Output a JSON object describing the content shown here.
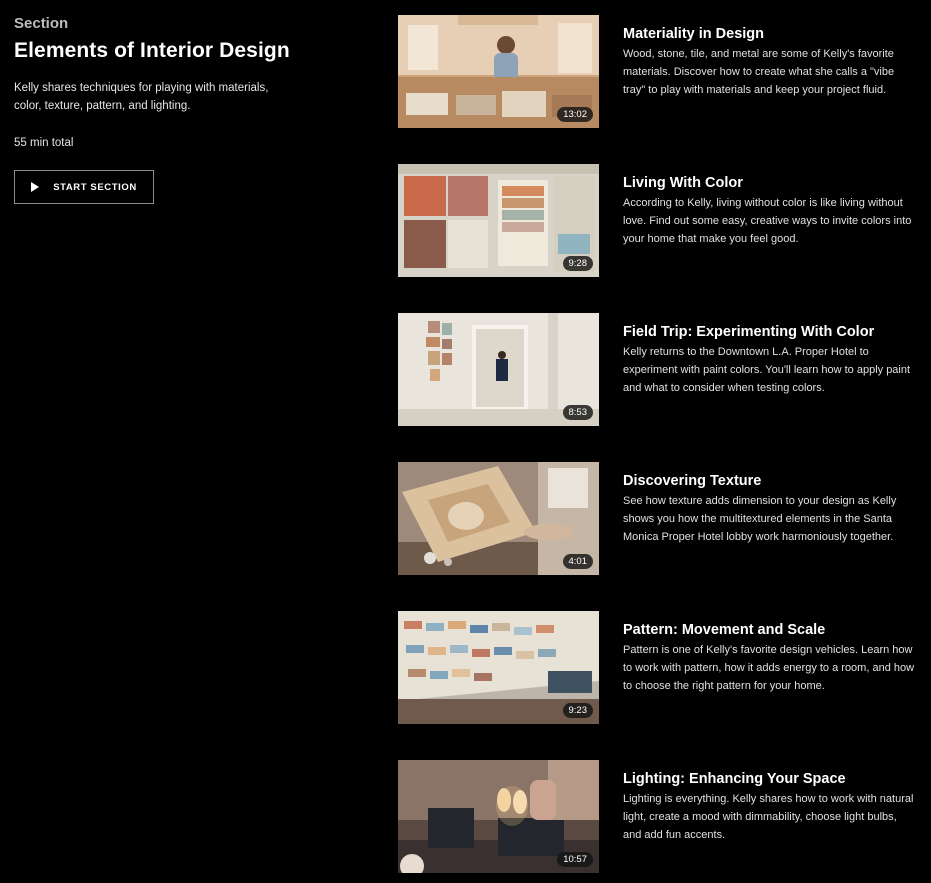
{
  "section": {
    "label": "Section",
    "title": "Elements of Interior Design",
    "description": "Kelly shares techniques for playing with materials, color, texture, pattern, and lighting.",
    "total": "55 min total",
    "start_button": "START SECTION"
  },
  "lessons": [
    {
      "title": "Materiality in Design",
      "description": "Wood, stone, tile, and metal are some of Kelly's favorite materials. Discover how to create what she calls a \"vibe tray\" to play with materials and keep your project fluid.",
      "duration": "13:02"
    },
    {
      "title": "Living With Color",
      "description": "According to Kelly, living without color is like living without love. Find out some easy, creative ways to invite colors into your home that make you feel good.",
      "duration": "9:28"
    },
    {
      "title": "Field Trip: Experimenting With Color",
      "description": "Kelly returns to the Downtown L.A. Proper Hotel to experiment with paint colors. You'll learn how to apply paint and what to consider when testing colors.",
      "duration": "8:53"
    },
    {
      "title": "Discovering Texture",
      "description": "See how texture adds dimension to your design as Kelly shows you how the multitextured elements in the Santa Monica Proper Hotel lobby work harmoniously together.",
      "duration": "4:01"
    },
    {
      "title": "Pattern: Movement and Scale",
      "description": "Pattern is one of Kelly's favorite design vehicles. Learn how to work with pattern, how it adds energy to a room, and how to choose the right pattern for your home.",
      "duration": "9:23"
    },
    {
      "title": "Lighting: Enhancing Your Space",
      "description": "Lighting is everything. Kelly shares how to work with natural light, create a mood with dimmability, choose light bulbs, and add fun accents.",
      "duration": "10:57"
    }
  ],
  "colors": {
    "background": "#000000",
    "text": "#ffffff",
    "muted": "#bdbdbd",
    "button_border": "#8a8a8a"
  },
  "icons": {
    "start_button": "play-icon"
  }
}
